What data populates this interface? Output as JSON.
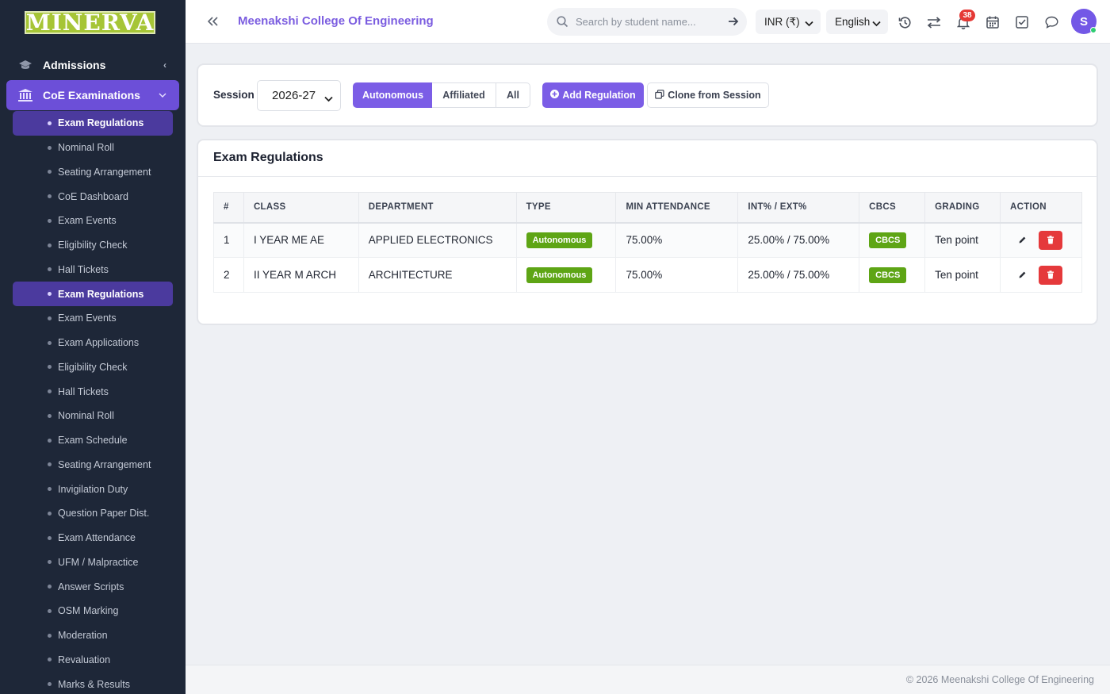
{
  "sidebar": {
    "logo": "MINERVA",
    "admissions_label": "Admissions",
    "coe_label": "CoE Examinations",
    "items": [
      {
        "label": "Exam Regulations",
        "active": true
      },
      {
        "label": "Nominal Roll"
      },
      {
        "label": "Seating Arrangement"
      },
      {
        "label": "CoE Dashboard"
      },
      {
        "label": "Exam Events"
      },
      {
        "label": "Eligibility Check"
      },
      {
        "label": "Hall Tickets"
      },
      {
        "label": "Exam Regulations",
        "active": true
      },
      {
        "label": "Exam Events"
      },
      {
        "label": "Exam Applications"
      },
      {
        "label": "Eligibility Check"
      },
      {
        "label": "Hall Tickets"
      },
      {
        "label": "Nominal Roll"
      },
      {
        "label": "Exam Schedule"
      },
      {
        "label": "Seating Arrangement"
      },
      {
        "label": "Invigilation Duty"
      },
      {
        "label": "Question Paper Dist."
      },
      {
        "label": "Exam Attendance"
      },
      {
        "label": "UFM / Malpractice"
      },
      {
        "label": "Answer Scripts"
      },
      {
        "label": "OSM Marking"
      },
      {
        "label": "Moderation"
      },
      {
        "label": "Revaluation"
      },
      {
        "label": "Marks & Results"
      }
    ]
  },
  "header": {
    "college": "Meenakshi College Of Engineering",
    "search_placeholder": "Search by student name...",
    "currency": "INR (₹)",
    "language": "English",
    "notification_count": "38",
    "avatar_initial": "S"
  },
  "filters": {
    "session_label": "Session",
    "session_value": "2026-27",
    "segments": {
      "autonomous": "Autonomous",
      "affiliated": "Affiliated",
      "all": "All"
    },
    "add_button": "Add Regulation",
    "clone_button": "Clone from Session"
  },
  "regulations": {
    "title": "Exam Regulations",
    "columns": [
      "#",
      "CLASS",
      "DEPARTMENT",
      "TYPE",
      "MIN ATTENDANCE",
      "INT% / EXT%",
      "CBCS",
      "GRADING",
      "ACTION"
    ],
    "rows": [
      {
        "no": "1",
        "class": "I YEAR ME AE",
        "department": "APPLIED ELECTRONICS",
        "type": "Autonomous",
        "min_attendance": "75.00%",
        "int_ext": "25.00% / 75.00%",
        "cbcs": "CBCS",
        "grading": "Ten point"
      },
      {
        "no": "2",
        "class": "II YEAR M ARCH",
        "department": "ARCHITECTURE",
        "type": "Autonomous",
        "min_attendance": "75.00%",
        "int_ext": "25.00% / 75.00%",
        "cbcs": "CBCS",
        "grading": "Ten point"
      }
    ]
  },
  "footer": {
    "text": "© 2026 Meenakshi College Of Engineering"
  },
  "colors": {
    "accent": "#7b5de6",
    "sidebar": "#1e2738",
    "success": "#5ea515",
    "danger": "#e5393b"
  }
}
